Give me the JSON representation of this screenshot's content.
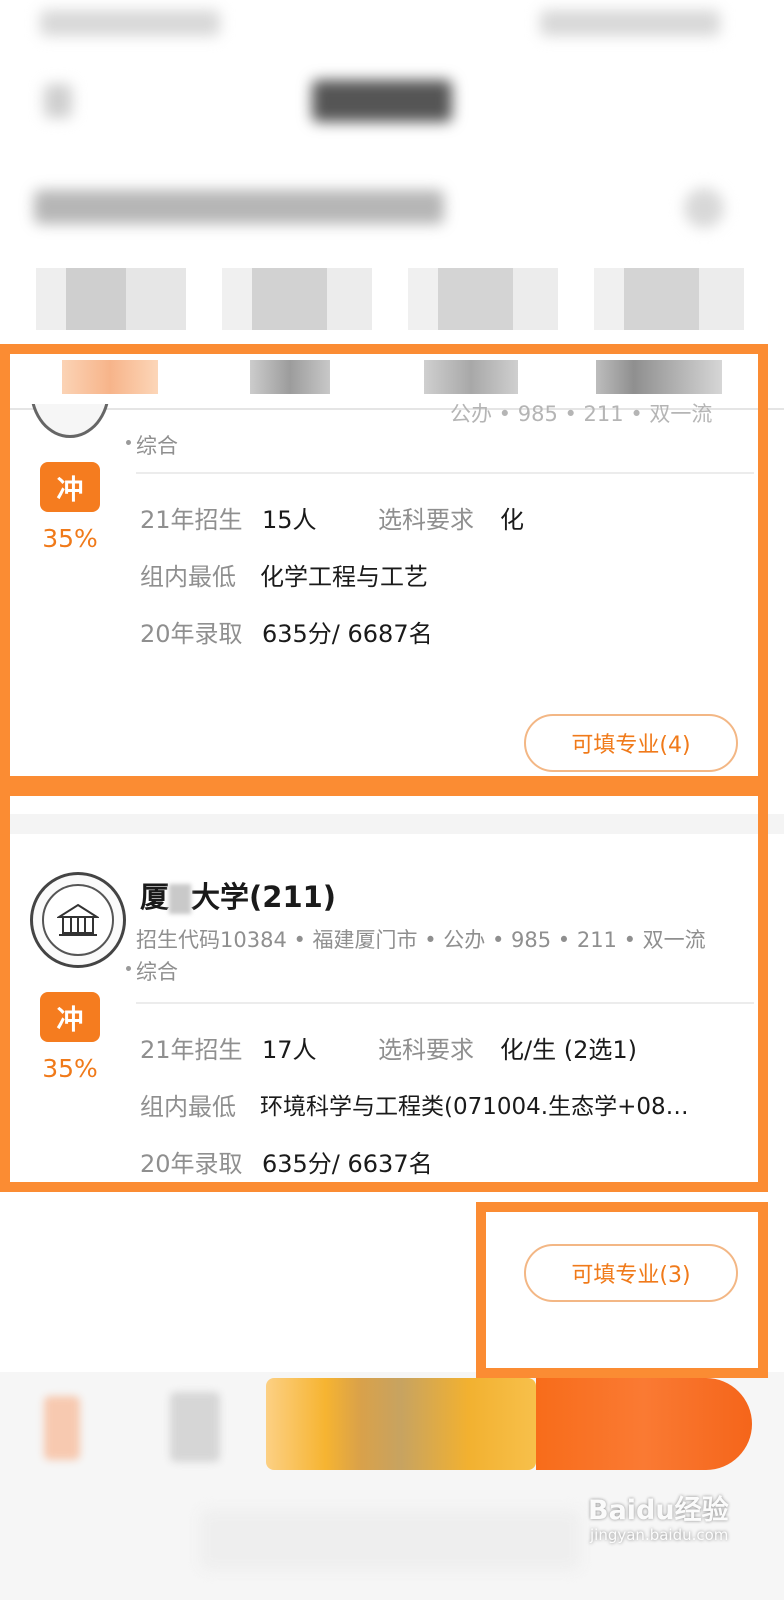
{
  "colors": {
    "accent": "#f57c1f",
    "frame": "#fb8c33",
    "label_gray": "#8f8f8f"
  },
  "cards": [
    {
      "name_visible": "",
      "info_line": "综合",
      "badge": "冲",
      "probability": "35%",
      "enroll_label": "21年招生",
      "enroll_value": "15人",
      "subject_label": "选科要求",
      "subject_value": "化",
      "min_label": "组内最低",
      "min_value": "化学工程与工艺",
      "admit_label": "20年录取",
      "admit_value": "635分/ 6687名",
      "button": "可填专业(4)"
    },
    {
      "name_visible": "大学(211)",
      "name_prefix": "厦",
      "info_line": "招生代码10384 • 福建厦门市 • 公办 • 985 • 211 • 双一流",
      "info_line2": "综合",
      "badge": "冲",
      "probability": "35%",
      "enroll_label": "21年招生",
      "enroll_value": "17人",
      "subject_label": "选科要求",
      "subject_value": "化/生 (2选1)",
      "min_label": "组内最低",
      "min_value": "环境科学与工程类(071004.生态学+08…",
      "admit_label": "20年录取",
      "admit_value": "635分/ 6637名",
      "button": "可填专业(3)"
    }
  ],
  "first_card_partial": "公办 • 985 • 211 • 双一流",
  "watermark": {
    "logo": "Baidu经验",
    "url": "jingyan.baidu.com"
  }
}
